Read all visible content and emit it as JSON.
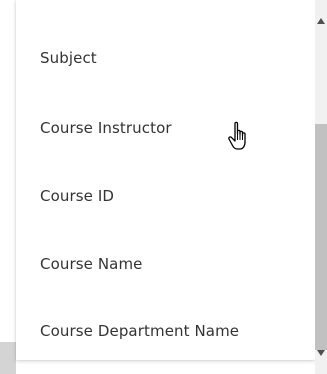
{
  "dropdown": {
    "items": [
      {
        "label": "Subject"
      },
      {
        "label": "Course Instructor"
      },
      {
        "label": "Course ID"
      },
      {
        "label": "Course Name"
      },
      {
        "label": "Course Department Name"
      }
    ]
  },
  "icons": {
    "cursor": "hand-pointer-icon",
    "scroll_up": "triangle-up-icon",
    "scroll_down": "triangle-down-icon"
  },
  "colors": {
    "text": "#333333",
    "scroll_track": "#f1f1f1",
    "scroll_thumb": "#c1c1c1"
  }
}
